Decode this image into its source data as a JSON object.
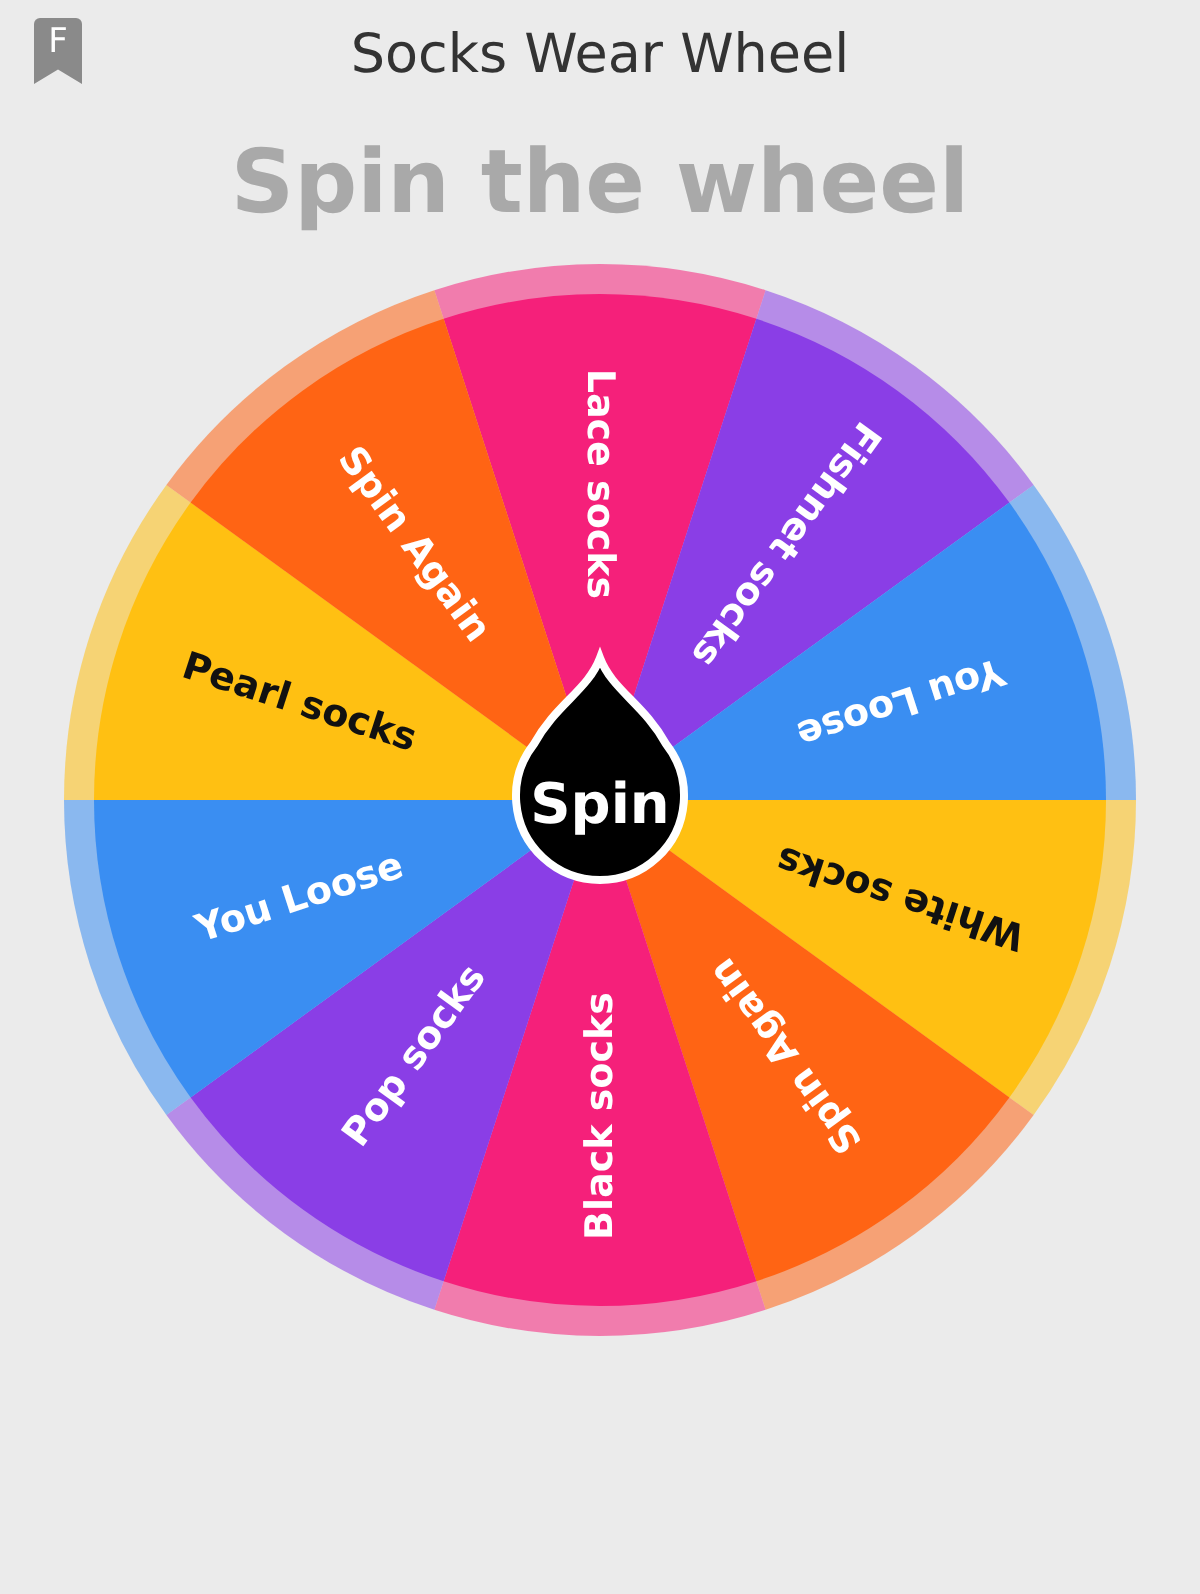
{
  "header": {
    "badge": "F",
    "title": "Socks Wear Wheel"
  },
  "heading": "Spin the wheel",
  "wheel": {
    "button": "Spin",
    "segments": [
      {
        "label": "Lace socks",
        "color": "#f5207a"
      },
      {
        "label": "Fishnet socks",
        "color": "#8a3ee6"
      },
      {
        "label": "You Loose",
        "color": "#3a8ef2"
      },
      {
        "label": "White socks",
        "color": "#ffc012"
      },
      {
        "label": "Spin Again",
        "color": "#ff6414"
      },
      {
        "label": "Black socks",
        "color": "#f5207a"
      },
      {
        "label": "Pop socks",
        "color": "#8a3ee6"
      },
      {
        "label": "You Loose",
        "color": "#3a8ef2"
      },
      {
        "label": "Pearl socks",
        "color": "#ffc012"
      },
      {
        "label": "Spin Again",
        "color": "#ff6414"
      }
    ]
  }
}
